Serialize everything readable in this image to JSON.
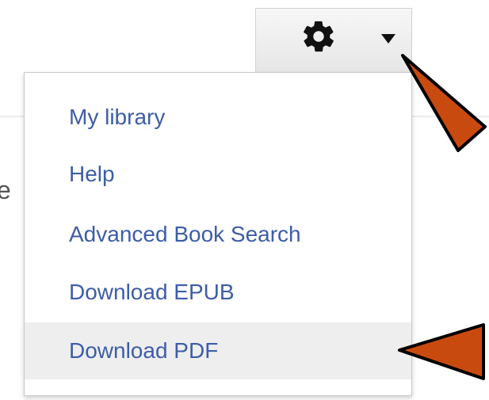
{
  "page": {
    "fragment_text": "e"
  },
  "settings": {
    "gear_icon": "gear-icon",
    "caret_icon": "caret-down-icon"
  },
  "menu": {
    "items": [
      {
        "label": "My library"
      },
      {
        "label": "Help"
      },
      {
        "label": "Advanced Book Search"
      },
      {
        "label": "Download EPUB"
      },
      {
        "label": "Download PDF",
        "highlighted": true
      }
    ]
  },
  "annotations": {
    "arrow_color": "#c94a0f",
    "arrow_stroke": "#000000",
    "link_color": "#3d5da8",
    "highlight_color": "#eeeeee"
  }
}
